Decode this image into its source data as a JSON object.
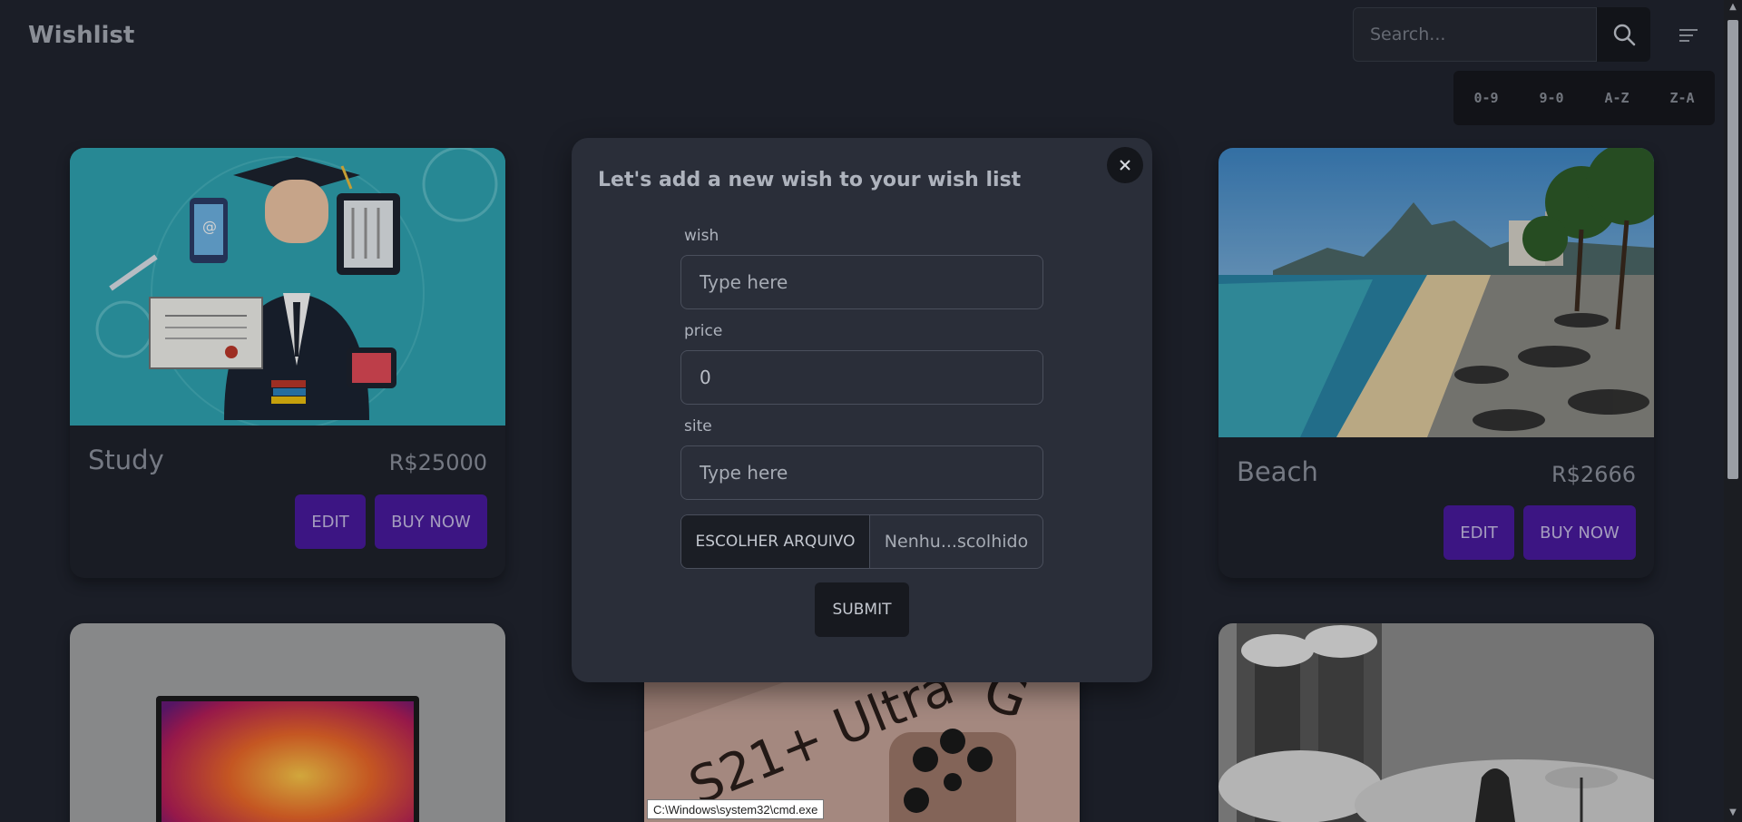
{
  "header": {
    "brand": "Wishlist",
    "search_placeholder": "Search...",
    "search_icon": "search-icon",
    "menu_icon": "menu-icon"
  },
  "sort": {
    "buttons": [
      "0-9",
      "9-0",
      "A-Z",
      "Z-A"
    ]
  },
  "cards": [
    {
      "title": "Study",
      "price": "R$25000",
      "edit": "EDIT",
      "buy": "BUY NOW"
    },
    {
      "title": "Beach",
      "price": "R$2666",
      "edit": "EDIT",
      "buy": "BUY NOW"
    }
  ],
  "modal": {
    "title": "Let's add a new wish to your wish list",
    "close_icon": "close-icon",
    "fields": {
      "wish_label": "wish",
      "wish_placeholder": "Type here",
      "price_label": "price",
      "price_value": "0",
      "site_label": "site",
      "site_placeholder": "Type here"
    },
    "file_button": "ESCOLHER ARQUIVO",
    "file_name": "Nenhu...scolhido",
    "submit": "SUBMIT"
  },
  "phone_image_text": "S21+ Ultra",
  "tooltip": "C:\\Windows\\system32\\cmd.exe",
  "colors": {
    "background": "#212530",
    "accent": "#4a1aa0",
    "modal": "#2a2e39"
  }
}
